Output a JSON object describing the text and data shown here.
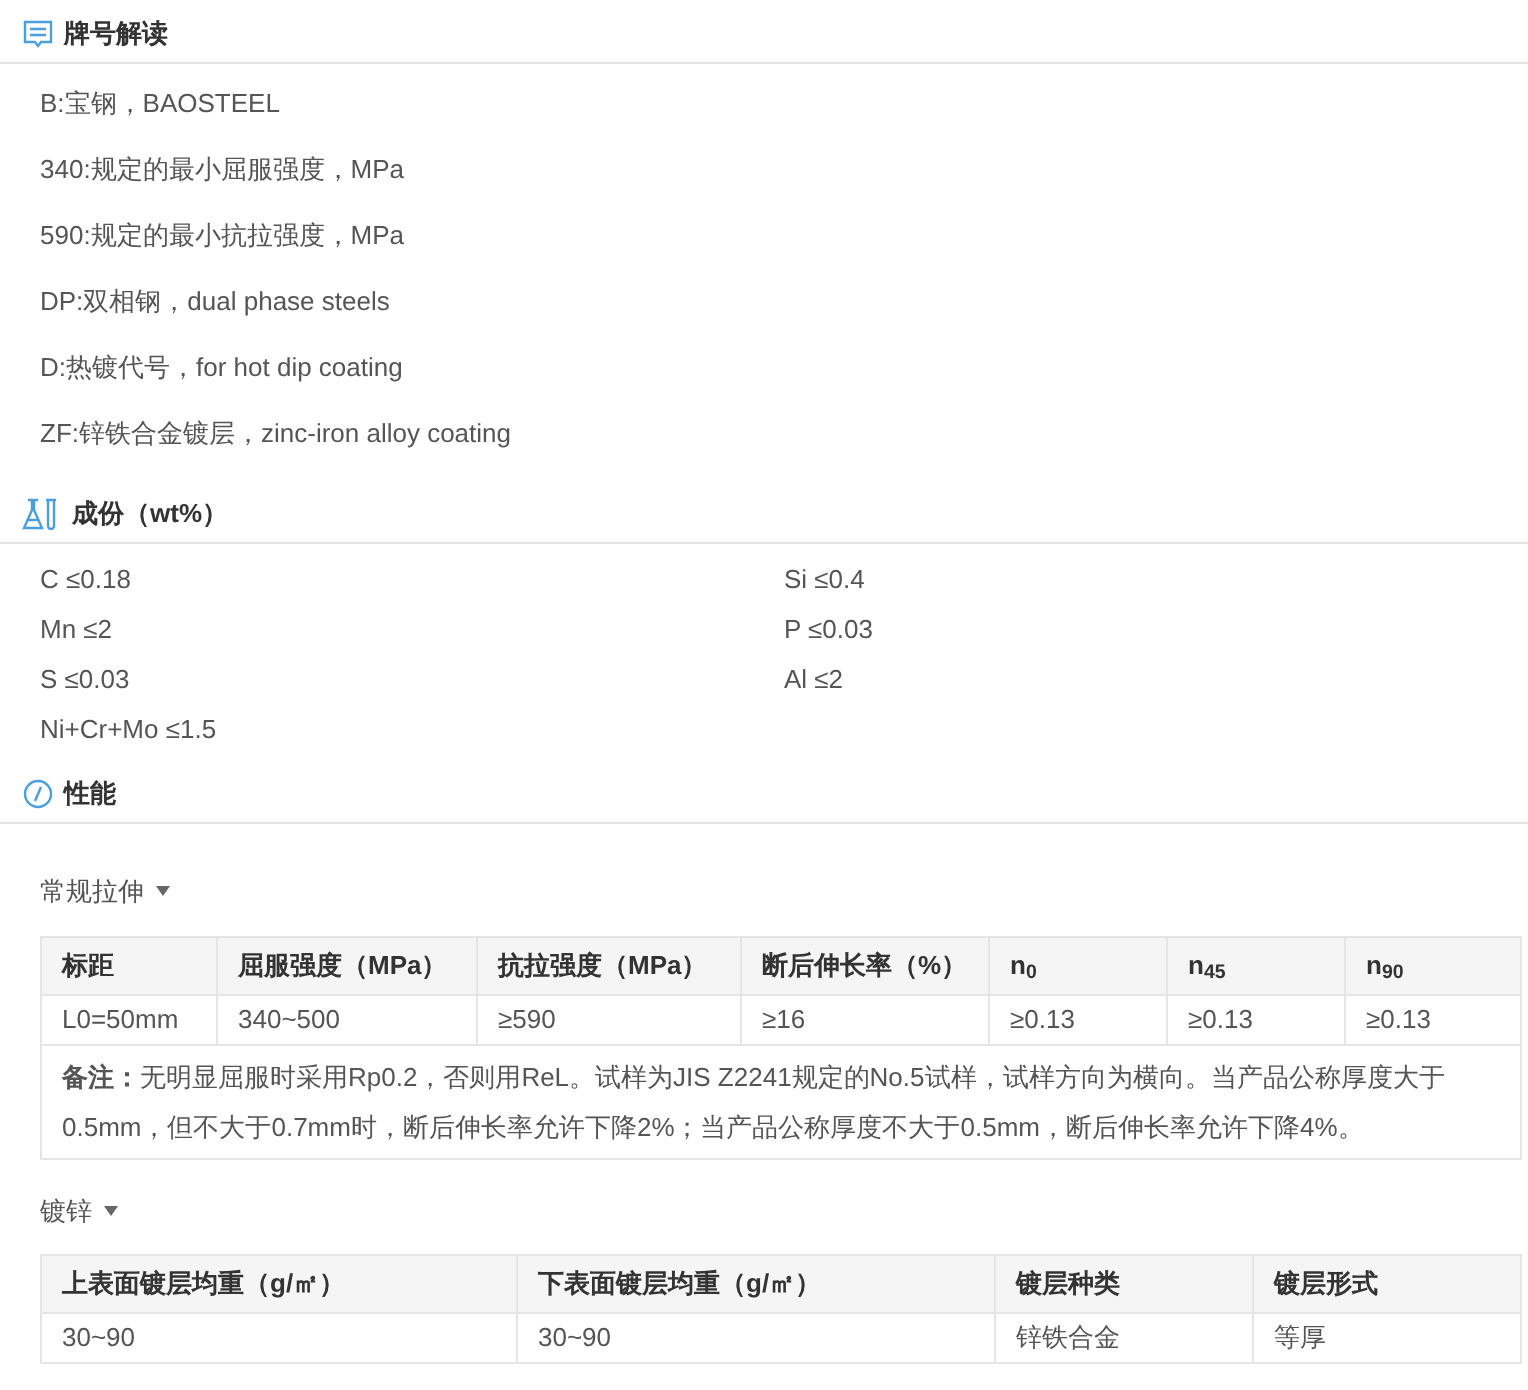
{
  "grade_reading": {
    "title": "牌号解读",
    "items": [
      "B:宝钢，BAOSTEEL",
      "340:规定的最小屈服强度，MPa",
      "590:规定的最小抗拉强度，MPa",
      "DP:双相钢，dual phase steels",
      "D:热镀代号，for hot dip coating",
      "ZF:锌铁合金镀层，zinc-iron alloy coating"
    ]
  },
  "composition": {
    "title": "成份（wt%）",
    "items": [
      "C ≤0.18",
      "Si ≤0.4",
      "Mn ≤2",
      "P ≤0.03",
      "S ≤0.03",
      "Al ≤2",
      "Ni+Cr+Mo ≤1.5"
    ]
  },
  "properties": {
    "title": "性能",
    "tables": [
      {
        "title": "常规拉伸",
        "columns": [
          "标距",
          "屈服强度（MPa）",
          "抗拉强度（MPa）",
          "断后伸长率（%）",
          "n$_{0}$",
          "n$_{45}$",
          "n$_{90}$"
        ],
        "rows": [
          [
            "L0=50mm",
            "340~500",
            "≥590",
            "≥16",
            "≥0.13",
            "≥0.13",
            "≥0.13"
          ]
        ],
        "note": "**备注：**无明显屈服时采用Rp0.2，否则用ReL。试样为JIS Z2241规定的No.5试样，试样方向为横向。当产品公称厚度大于0.5mm，但不大于0.7mm时，断后伸长率允许下降2%；当产品公称厚度不大于0.5mm，断后伸长率允许下降4%。"
      },
      {
        "title": "镀锌",
        "columns": [
          "上表面镀层均重（g/㎡）",
          "下表面镀层均重（g/㎡）",
          "镀层种类",
          "镀层形式"
        ],
        "rows": [
          [
            "30~90",
            "30~90",
            "锌铁合金",
            "等厚"
          ]
        ]
      }
    ]
  }
}
